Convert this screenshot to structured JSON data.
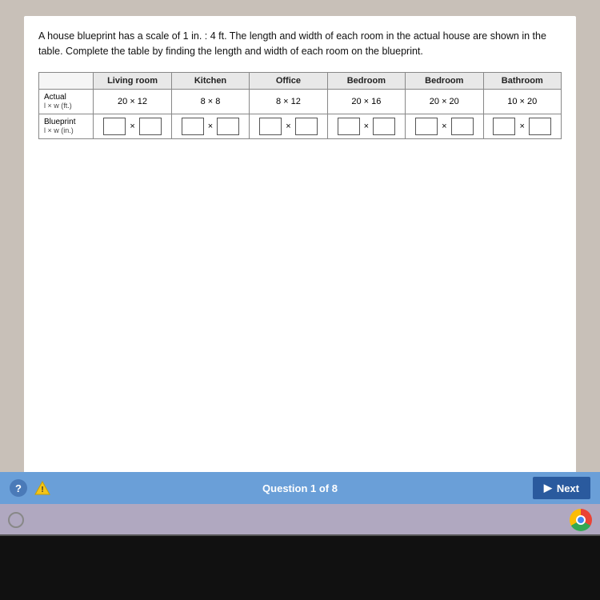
{
  "question": {
    "text": "A house blueprint has a scale of 1 in. : 4 ft. The length and width of each room in the actual house are shown in the table. Complete the table by finding the length and width of each room on the blueprint.",
    "counter": "Question 1 of 8"
  },
  "table": {
    "row_header_empty": "",
    "columns": [
      "Living room",
      "Kitchen",
      "Office",
      "Bedroom",
      "Bedroom",
      "Bathroom"
    ],
    "actual_label": "Actual",
    "actual_sublabel": "l × w (ft.)",
    "actual_values": [
      "20 × 12",
      "8 × 8",
      "8 × 12",
      "20 × 16",
      "20 × 20",
      "10 × 20"
    ],
    "blueprint_label": "Blueprint",
    "blueprint_sublabel": "l × w (in.)"
  },
  "toolbar": {
    "help_label": "?",
    "warning_label": "⚠",
    "next_label": "Next",
    "next_icon": "▶"
  }
}
